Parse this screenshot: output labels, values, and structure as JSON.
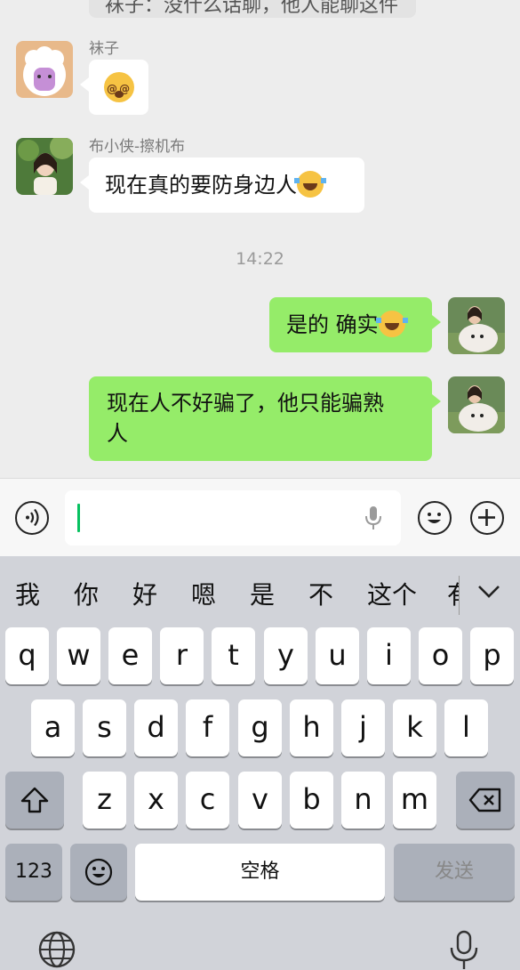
{
  "chat": {
    "partial_top_text": "袜子：没什么话聊，他人能聊这件",
    "messages": [
      {
        "sender": "袜子",
        "text": "",
        "emoji": "dizzy-face-emoji",
        "side": "left"
      },
      {
        "sender": "布小侠-擦机布",
        "text": "现在真的要防身边人",
        "emoji": "rolling-laugh-emoji",
        "side": "left"
      },
      {
        "sender": "",
        "text": "是的 确实",
        "emoji": "rolling-laugh-emoji",
        "side": "right"
      },
      {
        "sender": "",
        "text": "现在人不好骗了，他只能骗熟人",
        "side": "right"
      }
    ],
    "time_divider": "14:22",
    "bubble_right_2_line1": "现在人不好骗了，他只能骗熟",
    "bubble_right_2_line2": "人"
  },
  "input": {
    "value": "",
    "voice_icon": "voice-toggle-icon",
    "emoji_icon": "emoji-icon",
    "plus_icon": "plus-icon"
  },
  "keyboard": {
    "candidates": [
      "我",
      "你",
      "好",
      "嗯",
      "是",
      "不",
      "这个",
      "有"
    ],
    "row1": [
      "q",
      "w",
      "e",
      "r",
      "t",
      "y",
      "u",
      "i",
      "o",
      "p"
    ],
    "row2": [
      "a",
      "s",
      "d",
      "f",
      "g",
      "h",
      "j",
      "k",
      "l"
    ],
    "row3": [
      "z",
      "x",
      "c",
      "v",
      "b",
      "n",
      "m"
    ],
    "numbers_label": "123",
    "space_label": "空格",
    "send_label": "发送"
  },
  "colors": {
    "bubble_right": "#95ec69",
    "bubble_left": "#ffffff",
    "background": "#ededed",
    "keyboard_bg": "#d1d3d9",
    "cursor": "#07c160"
  }
}
